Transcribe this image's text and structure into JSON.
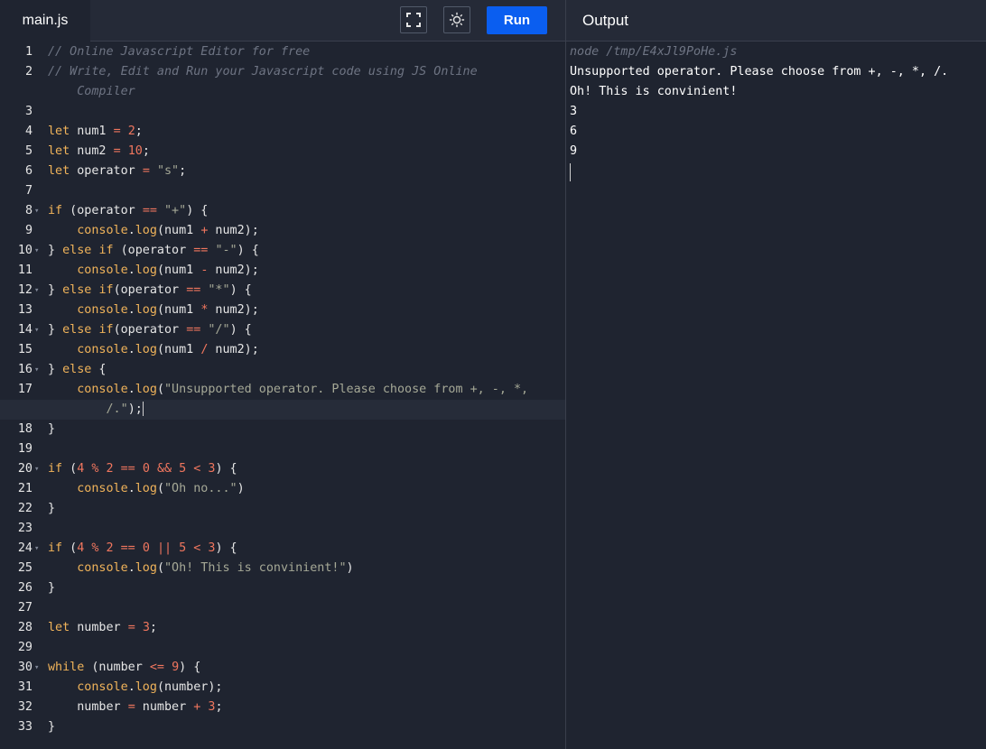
{
  "tab": {
    "filename": "main.js"
  },
  "toolbar": {
    "fullscreen_icon": "fullscreen-icon",
    "theme_icon": "sun-icon",
    "run_label": "Run",
    "run_color": "#0a5ef0"
  },
  "output": {
    "label": "Output",
    "command": "node /tmp/E4xJl9PoHe.js",
    "lines": [
      "Unsupported operator. Please choose from +, -, *, /.",
      "Oh! This is convinient!",
      "3",
      "6",
      "9"
    ]
  },
  "editor": {
    "lines": [
      {
        "n": "1",
        "code": "// Online Javascript Editor for free"
      },
      {
        "n": "2",
        "code": "// Write, Edit and Run your Javascript code using JS Online"
      },
      {
        "n": "",
        "code": "    Compiler"
      },
      {
        "n": "3",
        "code": ""
      },
      {
        "n": "4",
        "code": "let num1 = 2;"
      },
      {
        "n": "5",
        "code": "let num2 = 10;"
      },
      {
        "n": "6",
        "code": "let operator = \"s\";"
      },
      {
        "n": "7",
        "code": ""
      },
      {
        "n": "8",
        "code": "if (operator == \"+\") {"
      },
      {
        "n": "9",
        "code": "    console.log(num1 + num2);"
      },
      {
        "n": "10",
        "code": "} else if (operator == \"-\") {"
      },
      {
        "n": "11",
        "code": "    console.log(num1 - num2);"
      },
      {
        "n": "12",
        "code": "} else if(operator == \"*\") {"
      },
      {
        "n": "13",
        "code": "    console.log(num1 * num2);"
      },
      {
        "n": "14",
        "code": "} else if(operator == \"/\") {"
      },
      {
        "n": "15",
        "code": "    console.log(num1 / num2);"
      },
      {
        "n": "16",
        "code": "} else {"
      },
      {
        "n": "17",
        "code": "    console.log(\"Unsupported operator. Please choose from +, -, *,"
      },
      {
        "n": "",
        "code": "        /.\");"
      },
      {
        "n": "18",
        "code": "}"
      },
      {
        "n": "19",
        "code": ""
      },
      {
        "n": "20",
        "code": "if (4 % 2 == 0 && 5 < 3) {"
      },
      {
        "n": "21",
        "code": "    console.log(\"Oh no...\")"
      },
      {
        "n": "22",
        "code": "}"
      },
      {
        "n": "23",
        "code": ""
      },
      {
        "n": "24",
        "code": "if (4 % 2 == 0 || 5 < 3) {"
      },
      {
        "n": "25",
        "code": "    console.log(\"Oh! This is convinient!\")"
      },
      {
        "n": "26",
        "code": "}"
      },
      {
        "n": "27",
        "code": ""
      },
      {
        "n": "28",
        "code": "let number = 3;"
      },
      {
        "n": "29",
        "code": ""
      },
      {
        "n": "30",
        "code": "while (number <= 9) {"
      },
      {
        "n": "31",
        "code": "    console.log(number);"
      },
      {
        "n": "32",
        "code": "    number = number + 3;"
      },
      {
        "n": "33",
        "code": "}"
      }
    ]
  }
}
